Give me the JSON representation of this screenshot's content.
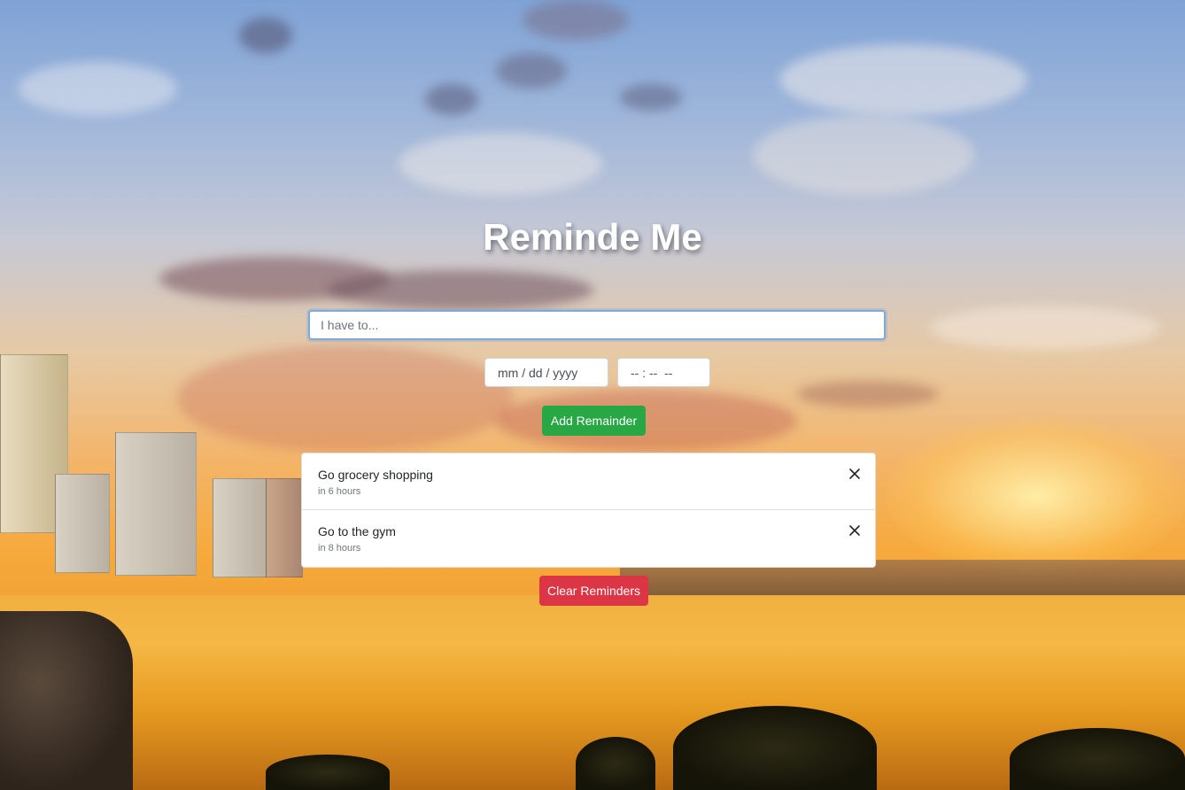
{
  "app": {
    "title": "Reminde Me"
  },
  "form": {
    "task_placeholder": "I have to...",
    "date_placeholder": "mm / dd / yyyy",
    "time_placeholder": "-- : --  --",
    "add_button_label": "Add Remainder"
  },
  "reminders": {
    "items": [
      {
        "text": "Go grocery shopping",
        "time": "in 6 hours"
      },
      {
        "text": "Go to the gym",
        "time": "in 8 hours"
      }
    ]
  },
  "clear_button_label": "Clear Reminders",
  "colors": {
    "add_button": "#28a745",
    "clear_button": "#dc3545",
    "input_focus_border": "#80a8d8"
  },
  "icons": {
    "remove_item": "close-icon"
  }
}
